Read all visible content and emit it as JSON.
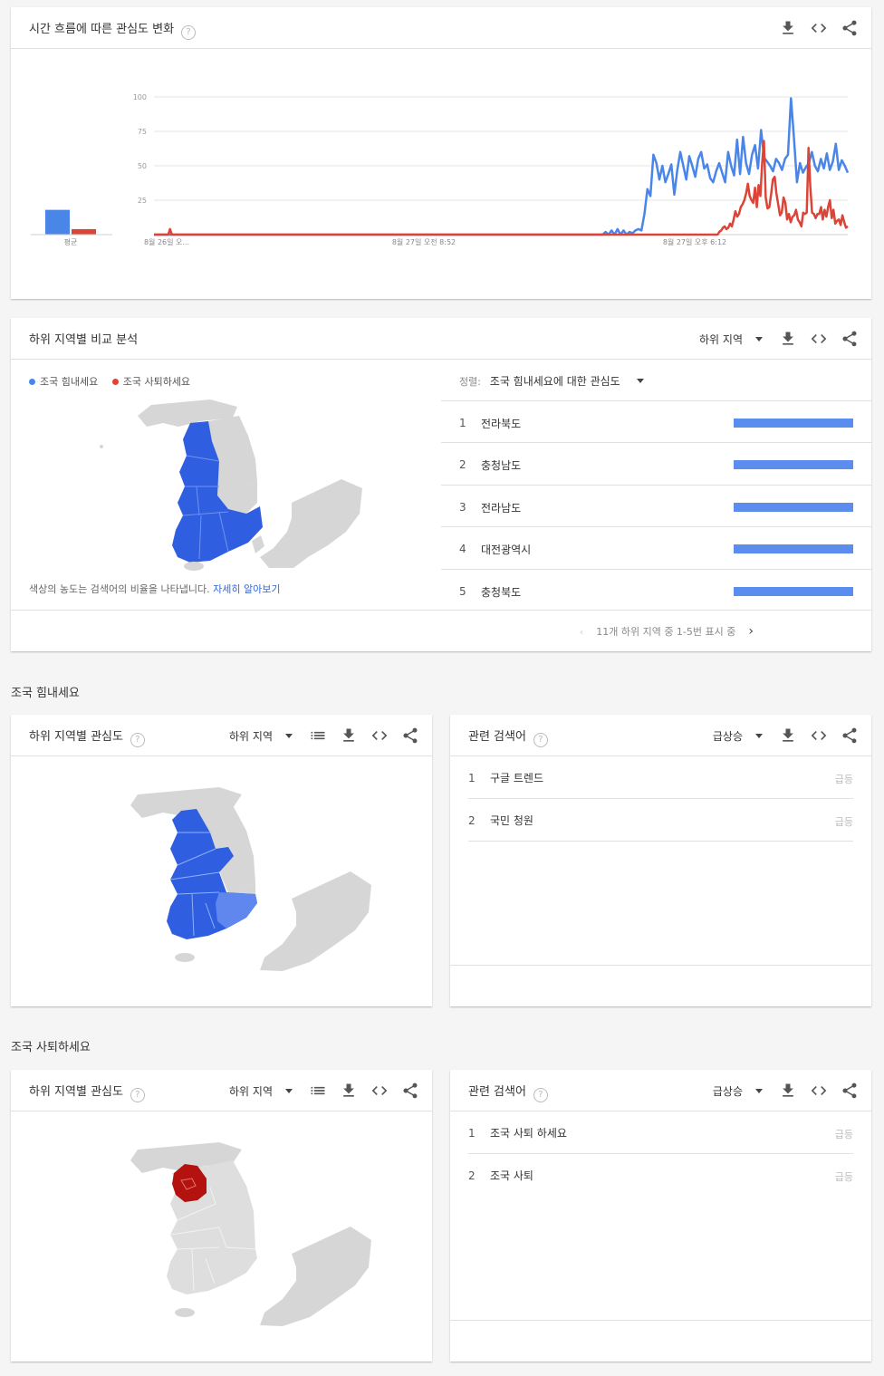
{
  "card1": {
    "title": "시간 흐름에 따른 관심도 변화",
    "avg_label": "평균",
    "y_ticks": [
      "100",
      "75",
      "50",
      "25"
    ],
    "x_ticks": [
      "8월 26일 오...",
      "8월 27일 오전 8:52",
      "8월 27일 오후 6:12"
    ]
  },
  "card2": {
    "title": "하위 지역별 비교 분석",
    "dropdown": "하위 지역",
    "legend": [
      "조국 힘내세요",
      "조국 사퇴하세요"
    ],
    "sort_label": "정렬:",
    "sort_value": "조국 힘내세요에 대한 관심도",
    "note": "색상의 농도는 검색어의 비율을 나타냅니다.",
    "note_link": "자세히 알아보기",
    "rows": [
      {
        "rank": "1",
        "name": "전라북도",
        "share": 1.0
      },
      {
        "rank": "2",
        "name": "충청남도",
        "share": 1.0
      },
      {
        "rank": "3",
        "name": "전라남도",
        "share": 1.0
      },
      {
        "rank": "4",
        "name": "대전광역시",
        "share": 1.0
      },
      {
        "rank": "5",
        "name": "충청북도",
        "share": 1.0
      }
    ],
    "pager": "11개 하위 지역 중 1-5번 표시 중"
  },
  "section1": {
    "label": "조국 힘내세요",
    "map_title": "하위 지역별 관심도",
    "map_dropdown": "하위 지역",
    "rq_title": "관련 검색어",
    "rq_dropdown": "급상승",
    "queries": [
      {
        "rank": "1",
        "text": "구글 트렌드",
        "badge": "급등"
      },
      {
        "rank": "2",
        "text": "국민 청원",
        "badge": "급등"
      }
    ]
  },
  "section2": {
    "label": "조국 사퇴하세요",
    "map_title": "하위 지역별 관심도",
    "map_dropdown": "하위 지역",
    "rq_title": "관련 검색어",
    "rq_dropdown": "급상승",
    "queries": [
      {
        "rank": "1",
        "text": "조국 사퇴 하세요",
        "badge": "급등"
      },
      {
        "rank": "2",
        "text": "조국 사퇴",
        "badge": "급등"
      }
    ]
  },
  "colors": {
    "blue": "#4a86e8",
    "red": "#db4437",
    "dark_red": "#b71c1c",
    "map_gray": "#d6d6d6"
  },
  "chart_data": {
    "type": "line",
    "title": "시간 흐름에 따른 관심도 변화",
    "xlabel": "",
    "ylabel": "",
    "ylim": [
      0,
      100
    ],
    "x_ticks": [
      "8월 26일 오...",
      "8월 27일 오전 8:52",
      "8월 27일 오후 6:12"
    ],
    "averages": [
      {
        "series": 0,
        "value": 18
      },
      {
        "series": 1,
        "value": 4
      }
    ],
    "series": [
      {
        "name": "조국 힘내세요",
        "color": "#4a86e8",
        "values": [
          0,
          0,
          0,
          0,
          0,
          0,
          0,
          0,
          0,
          0,
          0,
          0,
          0,
          0,
          0,
          0,
          0,
          0,
          0,
          0,
          0,
          0,
          0,
          0,
          0,
          0,
          0,
          0,
          0,
          0,
          0,
          0,
          0,
          0,
          0,
          0,
          0,
          0,
          0,
          0,
          0,
          0,
          0,
          0,
          0,
          0,
          0,
          0,
          0,
          0,
          0,
          0,
          0,
          0,
          0,
          0,
          0,
          0,
          0,
          0,
          0,
          0,
          0,
          0,
          0,
          0,
          0,
          0,
          0,
          0,
          0,
          0,
          0,
          0,
          0,
          0,
          0,
          0,
          0,
          0,
          0,
          0,
          0,
          0,
          0,
          0,
          0,
          0,
          0,
          0,
          0,
          0,
          0,
          0,
          0,
          0,
          0,
          0,
          0,
          0,
          0,
          0,
          0,
          0,
          0,
          0,
          0,
          0,
          0,
          0,
          0,
          0,
          0,
          0,
          0,
          0,
          0,
          0,
          0,
          0,
          0,
          0,
          0,
          0,
          0,
          0,
          0,
          0,
          0,
          0,
          0,
          0,
          0,
          0,
          0,
          0,
          0,
          0,
          0,
          0,
          0,
          0,
          0,
          0,
          0,
          0,
          0,
          0,
          0,
          0,
          0,
          2,
          0,
          3,
          0,
          4,
          0,
          3,
          0,
          2,
          1,
          3,
          4,
          3,
          15,
          33,
          28,
          58,
          52,
          40,
          50,
          38,
          44,
          51,
          29,
          47,
          60,
          50,
          40,
          57,
          50,
          42,
          55,
          60,
          48,
          51,
          41,
          38,
          46,
          52,
          45,
          38,
          60,
          50,
          43,
          69,
          44,
          71,
          52,
          44,
          58,
          65,
          48,
          76,
          56,
          53,
          50,
          46,
          55,
          52,
          47,
          55,
          58,
          99,
          70,
          38,
          52,
          45,
          49,
          52,
          60,
          50,
          46,
          55,
          48,
          59,
          47,
          53,
          66,
          47,
          54,
          50,
          45
        ]
      },
      {
        "name": "조국 사퇴하세요",
        "color": "#db4437",
        "values": [
          0,
          0,
          0,
          0,
          0,
          0,
          0,
          0,
          0,
          4,
          0,
          0,
          0,
          0,
          0,
          0,
          0,
          0,
          0,
          0,
          0,
          0,
          0,
          0,
          0,
          0,
          0,
          0,
          0,
          0,
          0,
          0,
          0,
          0,
          0,
          0,
          0,
          0,
          0,
          0,
          0,
          0,
          0,
          0,
          0,
          0,
          0,
          0,
          0,
          0,
          0,
          0,
          0,
          0,
          0,
          0,
          0,
          0,
          0,
          0,
          0,
          0,
          0,
          0,
          0,
          0,
          0,
          0,
          0,
          0,
          0,
          0,
          0,
          0,
          0,
          0,
          0,
          0,
          0,
          0,
          0,
          0,
          0,
          0,
          0,
          0,
          0,
          0,
          0,
          0,
          0,
          0,
          0,
          0,
          0,
          0,
          0,
          0,
          0,
          0,
          0,
          0,
          0,
          0,
          0,
          0,
          0,
          0,
          0,
          0,
          0,
          0,
          0,
          0,
          0,
          0,
          0,
          0,
          0,
          0,
          0,
          0,
          0,
          0,
          0,
          0,
          0,
          0,
          0,
          0,
          0,
          0,
          0,
          0,
          0,
          0,
          0,
          0,
          0,
          0,
          0,
          0,
          0,
          0,
          0,
          0,
          0,
          0,
          0,
          0,
          0,
          0,
          0,
          0,
          0,
          0,
          0,
          0,
          0,
          0,
          0,
          0,
          0,
          0,
          0,
          0,
          0,
          0,
          0,
          0,
          0,
          0,
          0,
          0,
          0,
          0,
          0,
          0,
          0,
          0,
          0,
          0,
          0,
          0,
          0,
          0,
          0,
          0,
          0,
          0,
          0,
          0,
          0,
          0,
          0,
          0,
          0,
          0,
          0,
          0,
          0,
          0,
          0,
          0,
          0,
          0,
          0,
          0,
          0,
          0,
          0,
          0,
          0,
          0,
          0,
          0,
          0,
          0,
          0,
          0,
          0,
          0,
          0,
          0,
          0,
          0,
          0,
          0,
          0,
          0,
          0,
          0,
          0,
          0,
          0,
          0,
          0,
          0,
          0,
          0,
          0,
          0,
          0,
          0,
          0,
          0,
          0,
          0,
          0,
          0,
          0,
          0,
          0,
          0,
          0,
          0,
          0,
          0,
          0,
          0,
          0,
          0,
          0,
          0,
          0,
          0,
          0,
          0,
          0,
          0,
          0,
          0,
          0,
          0,
          0,
          0,
          0,
          0,
          0,
          0,
          0,
          0,
          0,
          0,
          0,
          0,
          0,
          0,
          0,
          0,
          0,
          0,
          0,
          0,
          0,
          0,
          0,
          0,
          0,
          0,
          0,
          0,
          0,
          0,
          0,
          0,
          0,
          0,
          0,
          0,
          0,
          0,
          0,
          0,
          0,
          0,
          0,
          2,
          3,
          5,
          6,
          4,
          5,
          8,
          6,
          11,
          17,
          13,
          15,
          20,
          22,
          25,
          30,
          37,
          28,
          25,
          23,
          34,
          20,
          36,
          28,
          52,
          68,
          27,
          19,
          20,
          29,
          40,
          42,
          30,
          22,
          14,
          16,
          27,
          23,
          11,
          15,
          9,
          13,
          14,
          18,
          11,
          9,
          6,
          16,
          15,
          16,
          63,
          35,
          16,
          15,
          12,
          15,
          15,
          20,
          11,
          18,
          13,
          20,
          25,
          12,
          18,
          8,
          10,
          11,
          7,
          14,
          9,
          5,
          6
        ]
      }
    ]
  }
}
